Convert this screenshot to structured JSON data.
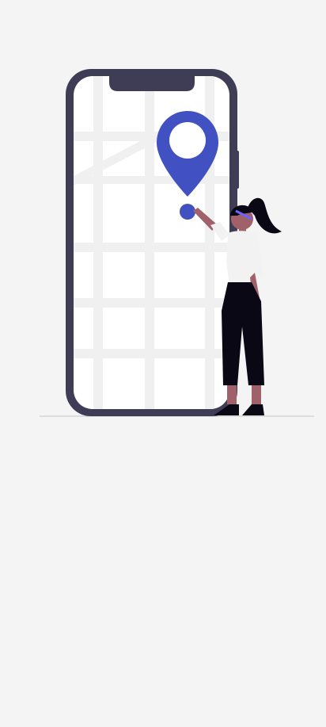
{
  "screen": {
    "background_color": "#f4f4f4"
  },
  "illustration": {
    "subject": "location-on-phone",
    "colors": {
      "phone_frame": "#3f3d56",
      "map_background": "#ffffff",
      "map_streets": "#f0f0f0",
      "pin": "#4151c2",
      "pin_center": "#ffffff",
      "ground_line": "#cfcfcf",
      "person_shirt": "#f2f2f2",
      "person_pants": "#090814",
      "person_skin": "#a0616a",
      "person_hair": "#090814",
      "headband": "#6c63ff"
    },
    "icons": [
      "location-pin-icon",
      "phone-icon",
      "person-icon"
    ]
  }
}
